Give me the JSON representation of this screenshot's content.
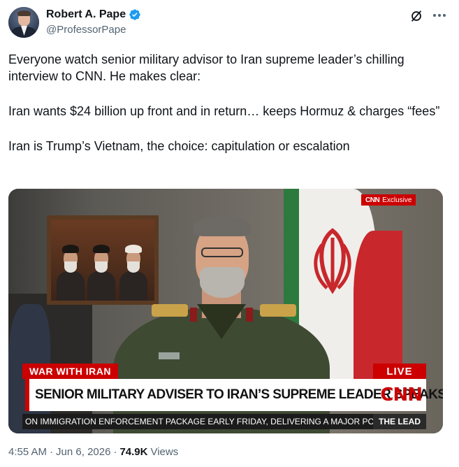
{
  "author": {
    "display_name": "Robert A. Pape",
    "handle": "@ProfessorPape",
    "verified": true
  },
  "icons": {
    "verified": "verified-badge-icon",
    "grok": "grok-icon",
    "more": "more-icon"
  },
  "tweet": {
    "paragraphs": [
      "Everyone watch senior military advisor to Iran supreme leader’s chilling interview to CNN. He makes clear:",
      "Iran wants $24 billion up front and in return… keeps Hormuz & charges “fees”",
      "Iran is Trump’s Vietnam, the choice: capitulation or escalation"
    ]
  },
  "media": {
    "exclusive_brand": "CNN",
    "exclusive_label": "Exclusive",
    "tag_left": "WAR WITH IRAN",
    "tag_right": "LIVE",
    "headline": "SENIOR MILITARY ADVISER TO IRAN’S SUPREME LEADER SPEAKS TO CNN",
    "logo": "CNN",
    "ticker": "ON IMMIGRATION ENFORCEMENT PACKAGE EARLY FRIDAY, DELIVERING A MAJOR POLIT",
    "show_name": "THE LEAD"
  },
  "meta": {
    "time": "4:55 AM",
    "separator": "·",
    "date": "Jun 6, 2026",
    "separator2": "·",
    "views_count": "74.9K",
    "views_label": "Views"
  },
  "colors": {
    "verified_blue": "#1d9bf0",
    "cnn_red": "#cc0000",
    "text_primary": "#0f1419",
    "text_secondary": "#536471"
  }
}
